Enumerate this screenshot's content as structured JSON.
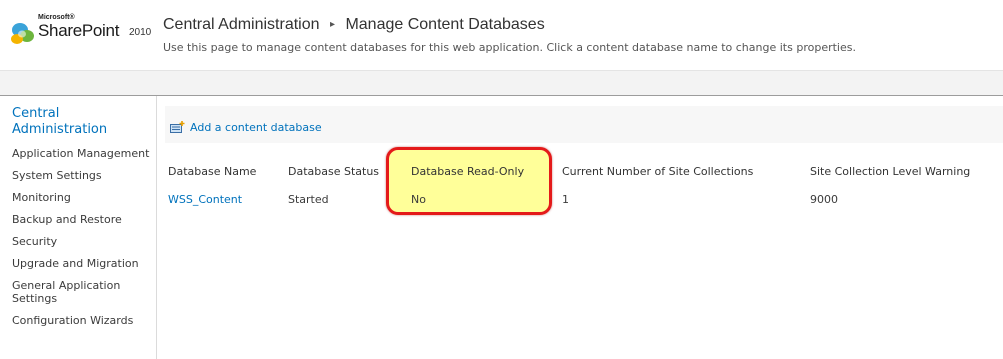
{
  "logo": {
    "microsoft": "Microsoft®",
    "product": "SharePoint",
    "year": "2010"
  },
  "breadcrumb": {
    "root": "Central Administration",
    "separator": "▸",
    "current": "Manage Content Databases"
  },
  "page_description": "Use this page to manage content databases for this web application. Click a content database name to change its properties.",
  "left_nav": {
    "home": "Central Administration",
    "items": [
      "Application Management",
      "System Settings",
      "Monitoring",
      "Backup and Restore",
      "Security",
      "Upgrade and Migration",
      "General Application Settings",
      "Configuration Wizards"
    ]
  },
  "toolbar": {
    "add_label": "Add a content database"
  },
  "table": {
    "headers": [
      "Database Name",
      "Database Status",
      "Database Read-Only",
      "Current Number of Site Collections",
      "Site Collection Level Warning"
    ],
    "rows": [
      [
        "WSS_Content",
        "Started",
        "No",
        "1",
        "9000"
      ]
    ]
  },
  "colors": {
    "link": "#0072bc",
    "highlight_fill": "#ffff99",
    "highlight_border": "#e41a1a"
  }
}
